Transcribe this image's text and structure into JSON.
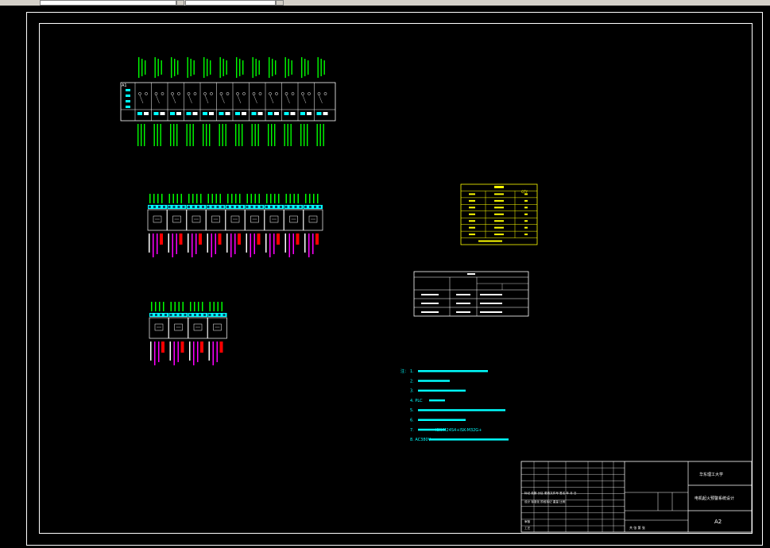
{
  "toolbar": {
    "field1": "",
    "field2": ""
  },
  "colors": {
    "background": "#000000",
    "line": "#ffffff",
    "cyan": "#00ffff",
    "green": "#00ff00",
    "magenta": "#ff00ff",
    "red": "#ff0000",
    "yellow": "#ffff00"
  },
  "panel_a1": {
    "tag": "A1",
    "terminal_count": 12
  },
  "panel_a2": {
    "module_count": 9
  },
  "panel_a3": {
    "module_count": 4
  },
  "yellow_table": {
    "col3_header": "QTY"
  },
  "white_table": {
    "rows": 3
  },
  "notes": {
    "prefix": "注：",
    "items": [
      "1.",
      "2.",
      "3.",
      "4.  PLC",
      "5.",
      "6.",
      "7.",
      "8.  AC380V"
    ],
    "item7_tail": "ISK-M24S4+ISK-M32G+",
    "line1_tail": "4mm.",
    "line2_tail": "4mm.",
    "line3_tail": ".5mm.",
    "line4_tail": "0.5mm.",
    "line5_tail": "1.0mm."
  },
  "title_block": {
    "school": "华东理工大学",
    "title": "电机起火预警系统设计",
    "scale_label": "比例",
    "sheet_label": "共 张  第 张",
    "size": "A2",
    "rows": [
      "标记  处数  分区  更改文件号  签名  年 月 日",
      "设计  标准化  阶段标记  重量  比例",
      "审核",
      "工艺"
    ]
  }
}
